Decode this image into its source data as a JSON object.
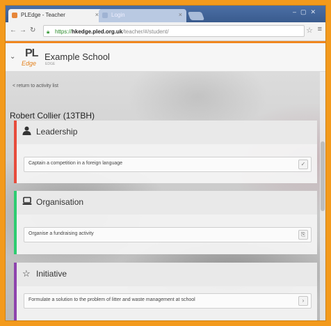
{
  "browser": {
    "tabs": [
      {
        "title": "PLEdge - Teacher",
        "active": true
      },
      {
        "title": "Login",
        "active": false
      }
    ],
    "url": {
      "scheme": "https://",
      "host": "hkedge.pled.org.uk",
      "path": "/teacher/#/student/"
    }
  },
  "header": {
    "logo_top": "PL",
    "logo_bottom": "Edge",
    "school_name": "Example School",
    "school_sub": "EDGE"
  },
  "nav": {
    "return_link": "< return to activity list"
  },
  "student": {
    "name": "Robert Collier (13TBH)"
  },
  "cards": [
    {
      "title": "Leadership",
      "icon": "person-icon",
      "color": "#e74c3c",
      "activity": "Captain a competition in a foreign language",
      "action_glyph": "✓"
    },
    {
      "title": "Organisation",
      "icon": "laptop-icon",
      "color": "#2ecc71",
      "activity": "Organise a fundraising activity",
      "action_glyph": "⎘"
    },
    {
      "title": "Initiative",
      "icon": "star-icon",
      "color": "#8e44ad",
      "activity": "Formulate a solution to the problem of litter and waste management at school",
      "action_glyph": "›"
    }
  ],
  "colors": {
    "accent": "#f0871e",
    "border": "#f39a1c"
  }
}
